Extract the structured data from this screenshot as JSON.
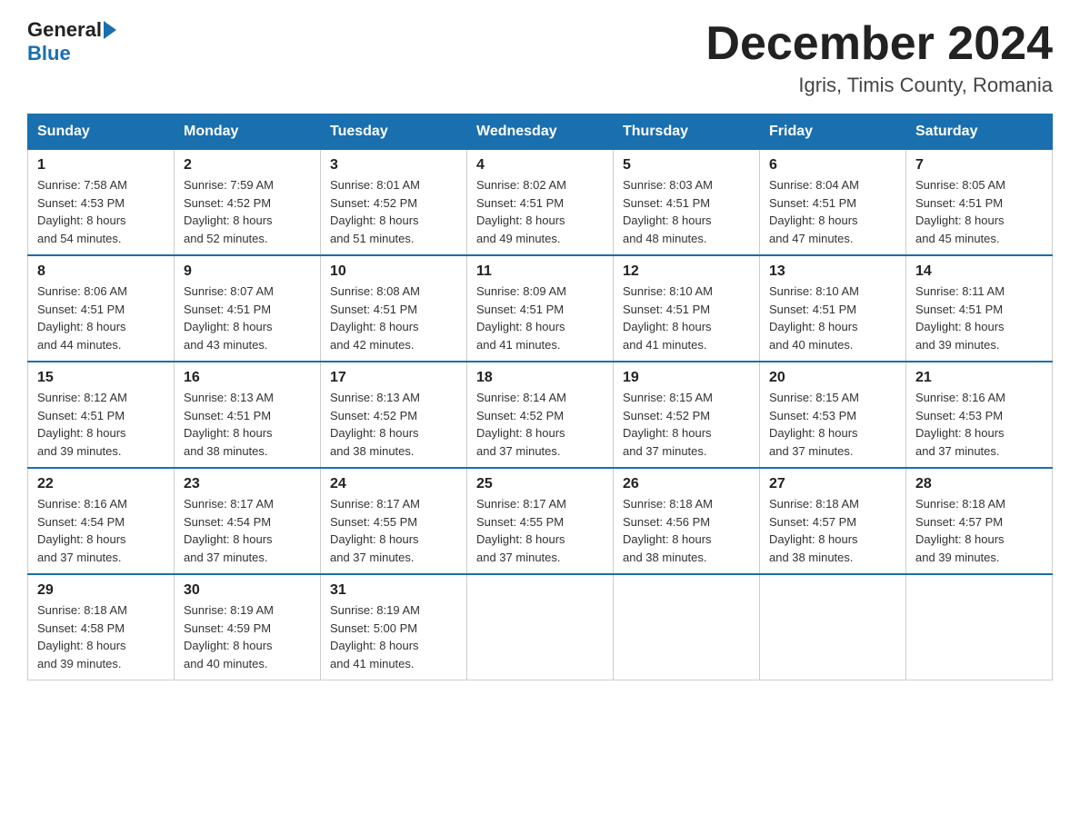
{
  "header": {
    "logo_text_general": "General",
    "logo_text_blue": "Blue",
    "month_title": "December 2024",
    "location": "Igris, Timis County, Romania"
  },
  "days_of_week": [
    "Sunday",
    "Monday",
    "Tuesday",
    "Wednesday",
    "Thursday",
    "Friday",
    "Saturday"
  ],
  "weeks": [
    [
      {
        "day": "1",
        "sunrise": "7:58 AM",
        "sunset": "4:53 PM",
        "daylight": "8 hours and 54 minutes."
      },
      {
        "day": "2",
        "sunrise": "7:59 AM",
        "sunset": "4:52 PM",
        "daylight": "8 hours and 52 minutes."
      },
      {
        "day": "3",
        "sunrise": "8:01 AM",
        "sunset": "4:52 PM",
        "daylight": "8 hours and 51 minutes."
      },
      {
        "day": "4",
        "sunrise": "8:02 AM",
        "sunset": "4:51 PM",
        "daylight": "8 hours and 49 minutes."
      },
      {
        "day": "5",
        "sunrise": "8:03 AM",
        "sunset": "4:51 PM",
        "daylight": "8 hours and 48 minutes."
      },
      {
        "day": "6",
        "sunrise": "8:04 AM",
        "sunset": "4:51 PM",
        "daylight": "8 hours and 47 minutes."
      },
      {
        "day": "7",
        "sunrise": "8:05 AM",
        "sunset": "4:51 PM",
        "daylight": "8 hours and 45 minutes."
      }
    ],
    [
      {
        "day": "8",
        "sunrise": "8:06 AM",
        "sunset": "4:51 PM",
        "daylight": "8 hours and 44 minutes."
      },
      {
        "day": "9",
        "sunrise": "8:07 AM",
        "sunset": "4:51 PM",
        "daylight": "8 hours and 43 minutes."
      },
      {
        "day": "10",
        "sunrise": "8:08 AM",
        "sunset": "4:51 PM",
        "daylight": "8 hours and 42 minutes."
      },
      {
        "day": "11",
        "sunrise": "8:09 AM",
        "sunset": "4:51 PM",
        "daylight": "8 hours and 41 minutes."
      },
      {
        "day": "12",
        "sunrise": "8:10 AM",
        "sunset": "4:51 PM",
        "daylight": "8 hours and 41 minutes."
      },
      {
        "day": "13",
        "sunrise": "8:10 AM",
        "sunset": "4:51 PM",
        "daylight": "8 hours and 40 minutes."
      },
      {
        "day": "14",
        "sunrise": "8:11 AM",
        "sunset": "4:51 PM",
        "daylight": "8 hours and 39 minutes."
      }
    ],
    [
      {
        "day": "15",
        "sunrise": "8:12 AM",
        "sunset": "4:51 PM",
        "daylight": "8 hours and 39 minutes."
      },
      {
        "day": "16",
        "sunrise": "8:13 AM",
        "sunset": "4:51 PM",
        "daylight": "8 hours and 38 minutes."
      },
      {
        "day": "17",
        "sunrise": "8:13 AM",
        "sunset": "4:52 PM",
        "daylight": "8 hours and 38 minutes."
      },
      {
        "day": "18",
        "sunrise": "8:14 AM",
        "sunset": "4:52 PM",
        "daylight": "8 hours and 37 minutes."
      },
      {
        "day": "19",
        "sunrise": "8:15 AM",
        "sunset": "4:52 PM",
        "daylight": "8 hours and 37 minutes."
      },
      {
        "day": "20",
        "sunrise": "8:15 AM",
        "sunset": "4:53 PM",
        "daylight": "8 hours and 37 minutes."
      },
      {
        "day": "21",
        "sunrise": "8:16 AM",
        "sunset": "4:53 PM",
        "daylight": "8 hours and 37 minutes."
      }
    ],
    [
      {
        "day": "22",
        "sunrise": "8:16 AM",
        "sunset": "4:54 PM",
        "daylight": "8 hours and 37 minutes."
      },
      {
        "day": "23",
        "sunrise": "8:17 AM",
        "sunset": "4:54 PM",
        "daylight": "8 hours and 37 minutes."
      },
      {
        "day": "24",
        "sunrise": "8:17 AM",
        "sunset": "4:55 PM",
        "daylight": "8 hours and 37 minutes."
      },
      {
        "day": "25",
        "sunrise": "8:17 AM",
        "sunset": "4:55 PM",
        "daylight": "8 hours and 37 minutes."
      },
      {
        "day": "26",
        "sunrise": "8:18 AM",
        "sunset": "4:56 PM",
        "daylight": "8 hours and 38 minutes."
      },
      {
        "day": "27",
        "sunrise": "8:18 AM",
        "sunset": "4:57 PM",
        "daylight": "8 hours and 38 minutes."
      },
      {
        "day": "28",
        "sunrise": "8:18 AM",
        "sunset": "4:57 PM",
        "daylight": "8 hours and 39 minutes."
      }
    ],
    [
      {
        "day": "29",
        "sunrise": "8:18 AM",
        "sunset": "4:58 PM",
        "daylight": "8 hours and 39 minutes."
      },
      {
        "day": "30",
        "sunrise": "8:19 AM",
        "sunset": "4:59 PM",
        "daylight": "8 hours and 40 minutes."
      },
      {
        "day": "31",
        "sunrise": "8:19 AM",
        "sunset": "5:00 PM",
        "daylight": "8 hours and 41 minutes."
      },
      null,
      null,
      null,
      null
    ]
  ],
  "labels": {
    "sunrise": "Sunrise:",
    "sunset": "Sunset:",
    "daylight": "Daylight:"
  }
}
